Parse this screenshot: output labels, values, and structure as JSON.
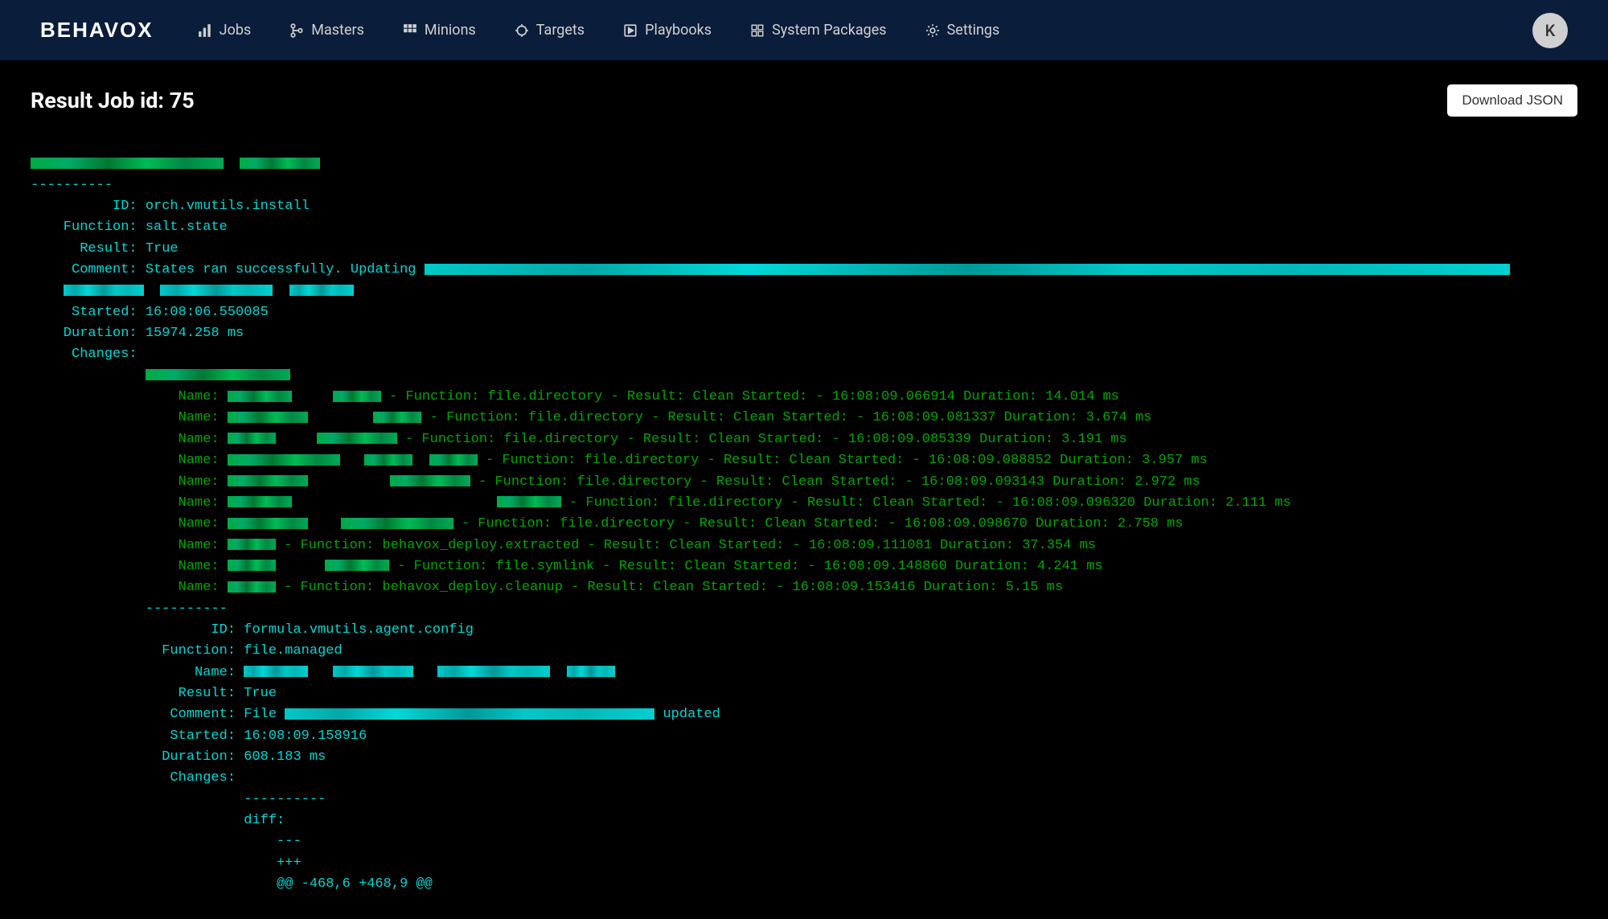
{
  "brand": "BEHAVOX",
  "nav": {
    "items": [
      {
        "label": "Jobs",
        "icon": "chart"
      },
      {
        "label": "Masters",
        "icon": "branch"
      },
      {
        "label": "Minions",
        "icon": "grid"
      },
      {
        "label": "Targets",
        "icon": "target"
      },
      {
        "label": "Playbooks",
        "icon": "play"
      },
      {
        "label": "System Packages",
        "icon": "package"
      },
      {
        "label": "Settings",
        "icon": "gear"
      }
    ]
  },
  "avatar_initial": "K",
  "page_title": "Result Job id: 75",
  "download_label": "Download JSON",
  "result1": {
    "divider": "----------",
    "id_label": "          ID:",
    "id_value": " orch.vmutils.install",
    "fn_label": "    Function:",
    "fn_value": " salt.state",
    "res_label": "      Result:",
    "res_value": " True",
    "com_label": "     Comment:",
    "com_prefix": " States ran successfully. Updating ",
    "start_label": "     Started:",
    "start_value": " 16:08:06.550085",
    "dur_label": "    Duration:",
    "dur_value": " 15974.258 ms",
    "chg_label": "     Changes:"
  },
  "changes": [
    {
      "pre": "                  Name: ",
      "post": " - Function: file.directory - Result: Clean Started: - 16:08:09.066914 Duration: 14.014 ms"
    },
    {
      "pre": "                  Name: ",
      "post": " - Function: file.directory - Result: Clean Started: - 16:08:09.081337 Duration: 3.674 ms"
    },
    {
      "pre": "                  Name: ",
      "post": " - Function: file.directory - Result: Clean Started: - 16:08:09.085339 Duration: 3.191 ms"
    },
    {
      "pre": "                  Name: ",
      "post": " - Function: file.directory - Result: Clean Started: - 16:08:09.088852 Duration: 3.957 ms"
    },
    {
      "pre": "                  Name: ",
      "post": " - Function: file.directory - Result: Clean Started: - 16:08:09.093143 Duration: 2.972 ms"
    },
    {
      "pre": "                  Name: ",
      "post": " - Function: file.directory - Result: Clean Started: - 16:08:09.096320 Duration: 2.111 ms"
    },
    {
      "pre": "                  Name: ",
      "post": " - Function: file.directory - Result: Clean Started: - 16:08:09.098670 Duration: 2.758 ms"
    },
    {
      "pre": "                  Name: ",
      "post": " - Function: behavox_deploy.extracted - Result: Clean Started: - 16:08:09.111081 Duration: 37.354 ms"
    },
    {
      "pre": "                  Name: ",
      "post": " - Function: file.symlink - Result: Clean Started: - 16:08:09.148860 Duration: 4.241 ms"
    },
    {
      "pre": "                  Name: ",
      "post": " - Function: behavox_deploy.cleanup - Result: Clean Started: - 16:08:09.153416 Duration: 5.15 ms"
    }
  ],
  "result2": {
    "divider": "              ----------",
    "id_label": "                      ID:",
    "id_value": " formula.vmutils.agent.config",
    "fn_label": "                Function:",
    "fn_value": " file.managed",
    "name_label": "                    Name:",
    "res_label": "                  Result:",
    "res_value": " True",
    "com_label": "                 Comment:",
    "com_pre": " File ",
    "com_post": " updated",
    "start_label": "                 Started:",
    "start_value": " 16:08:09.158916",
    "dur_label": "                Duration:",
    "dur_value": " 608.183 ms",
    "chg_label": "                 Changes:",
    "inner_div": "                          ----------",
    "diff": "                          diff:",
    "minus": "                              ---",
    "plus": "                              +++",
    "hunk": "                              @@ -468,6 +468,9 @@"
  }
}
